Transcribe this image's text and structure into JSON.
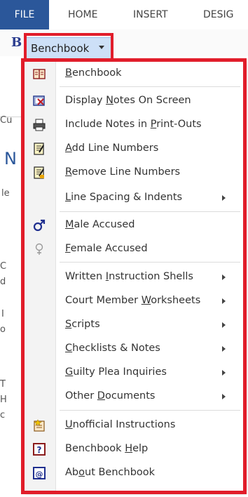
{
  "ribbon": {
    "tabs": [
      {
        "label": "FILE"
      },
      {
        "label": "HOME"
      },
      {
        "label": "INSERT"
      },
      {
        "label": "DESIG"
      }
    ]
  },
  "background": {
    "partial_texts": [
      "Cu",
      "N",
      "le",
      "C",
      "d",
      "I",
      "o",
      "T",
      "H",
      "c"
    ]
  },
  "menu_button": {
    "label": "Benchbook"
  },
  "menu": {
    "items": [
      {
        "pre": "",
        "acc": "B",
        "post": "enchbook",
        "icon": "book-icon"
      },
      {
        "pre": "Display ",
        "acc": "N",
        "post": "otes On Screen",
        "icon": "display-notes-icon"
      },
      {
        "pre": "Include Notes in ",
        "acc": "P",
        "post": "rint-Outs",
        "icon": "printer-icon"
      },
      {
        "pre": "",
        "acc": "A",
        "post": "dd Line Numbers",
        "icon": "add-lines-icon"
      },
      {
        "pre": "",
        "acc": "R",
        "post": "emove Line Numbers",
        "icon": "remove-lines-icon"
      },
      {
        "pre": "",
        "acc": "L",
        "post": "ine Spacing & Indents",
        "icon": ""
      },
      {
        "pre": "",
        "acc": "M",
        "post": "ale Accused",
        "icon": "male-symbol-icon"
      },
      {
        "pre": "",
        "acc": "F",
        "post": "emale Accused",
        "icon": "female-symbol-icon"
      },
      {
        "pre": "Written ",
        "acc": "I",
        "post": "nstruction Shells",
        "icon": ""
      },
      {
        "pre": "Court Member ",
        "acc": "W",
        "post": "orksheets",
        "icon": ""
      },
      {
        "pre": "",
        "acc": "S",
        "post": "cripts",
        "icon": ""
      },
      {
        "pre": "",
        "acc": "C",
        "post": "hecklists & Notes",
        "icon": ""
      },
      {
        "pre": "",
        "acc": "G",
        "post": "uilty Plea Inquiries",
        "icon": ""
      },
      {
        "pre": "Other ",
        "acc": "D",
        "post": "ocuments",
        "icon": ""
      },
      {
        "pre": "",
        "acc": "U",
        "post": "nofficial Instructions",
        "icon": "instructions-icon"
      },
      {
        "pre": "Benchbook ",
        "acc": "H",
        "post": "elp",
        "icon": "help-icon"
      },
      {
        "pre": "Ab",
        "acc": "o",
        "post": "ut Benchbook",
        "icon": "about-icon"
      }
    ]
  },
  "colors": {
    "highlight_red": "#e11d2a",
    "file_tab_blue": "#2b579a",
    "button_hover": "#cde0f7"
  }
}
